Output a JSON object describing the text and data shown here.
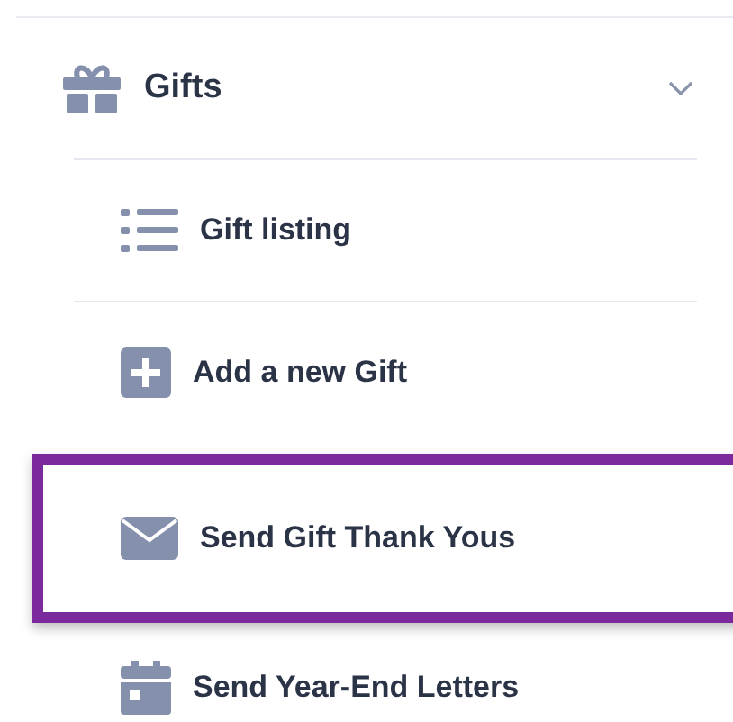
{
  "menu": {
    "label": "Gifts",
    "kind": "gift",
    "expanded": true,
    "children": [
      {
        "label": "Gift listing",
        "kind": "list",
        "highlighted": false
      },
      {
        "label": "Add a new Gift",
        "kind": "plus",
        "highlighted": false
      },
      {
        "label": "Send Gift Thank Yous",
        "kind": "envelope",
        "highlighted": true
      },
      {
        "label": "Send Year-End Letters",
        "kind": "calendar",
        "highlighted": false
      }
    ]
  }
}
